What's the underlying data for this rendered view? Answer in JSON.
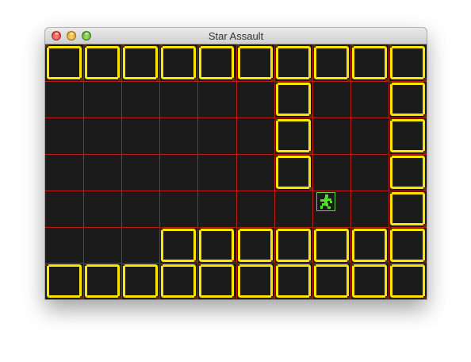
{
  "window": {
    "title": "Star Assault",
    "traffic_lights": [
      "close",
      "minimize",
      "zoom"
    ]
  },
  "colors": {
    "background": "#1b1b1b",
    "gridline": "#c01a1a",
    "block": "#ffe500",
    "player": "#4ee02b"
  },
  "level": {
    "columns": 10,
    "rows": 7,
    "map": [
      "##########",
      "......#..#",
      "......#..#",
      "......#..#",
      ".........#",
      "...#######",
      "##########"
    ],
    "player": {
      "col": 7,
      "row": 4
    }
  }
}
